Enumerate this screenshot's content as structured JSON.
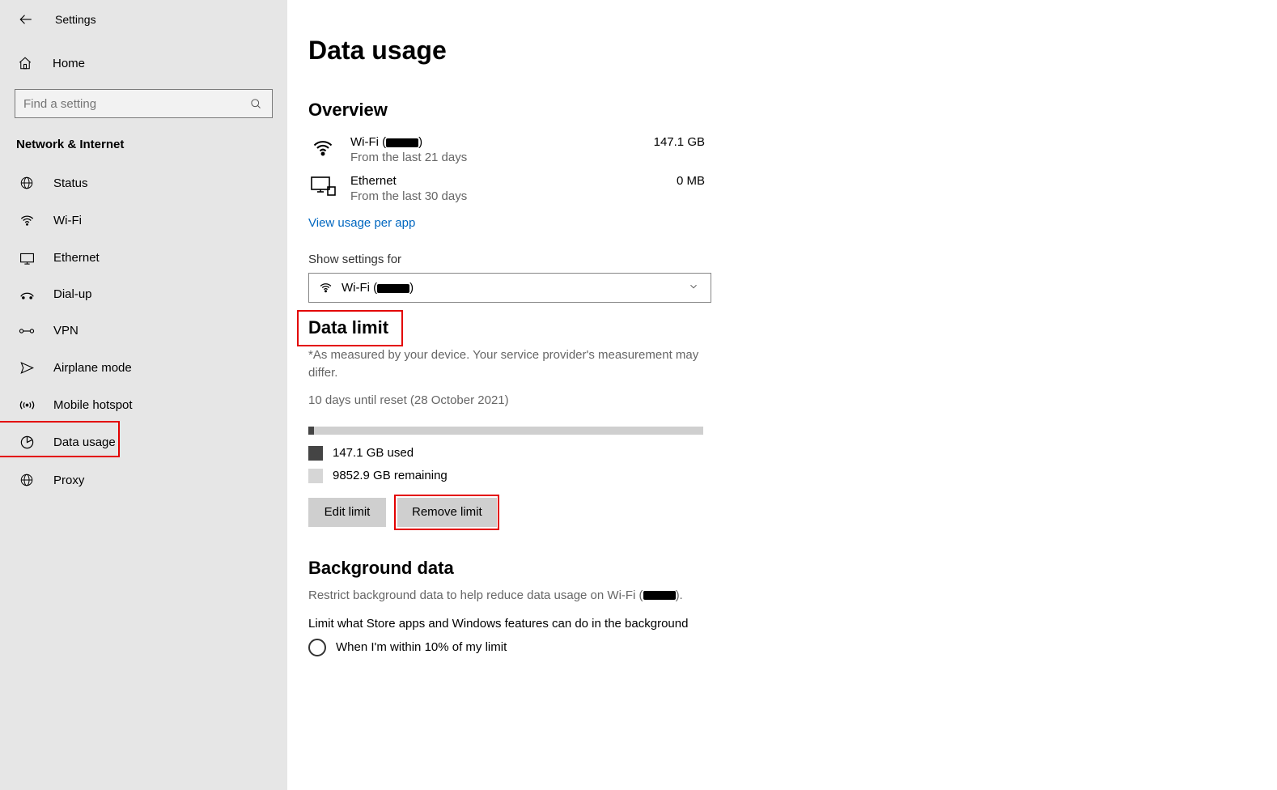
{
  "window": {
    "title": "Settings",
    "home_label": "Home",
    "search_placeholder": "Find a setting",
    "section_label": "Network & Internet"
  },
  "nav": {
    "status": "Status",
    "wifi": "Wi-Fi",
    "ethernet": "Ethernet",
    "dialup": "Dial-up",
    "vpn": "VPN",
    "airplane": "Airplane mode",
    "hotspot": "Mobile hotspot",
    "data_usage": "Data usage",
    "proxy": "Proxy"
  },
  "page": {
    "title": "Data usage",
    "overview_heading": "Overview",
    "wifi_name_prefix": "Wi-Fi (",
    "wifi_name_suffix": ")",
    "wifi_sub": "From the last 21 days",
    "wifi_value": "147.1 GB",
    "eth_name": "Ethernet",
    "eth_sub": "From the last 30 days",
    "eth_value": "0 MB",
    "view_per_app": "View usage per app",
    "show_for_label": "Show settings for",
    "dropdown_prefix": "Wi-Fi (",
    "dropdown_suffix": ")",
    "data_limit_heading": "Data limit",
    "data_limit_note": "*As measured by your device. Your service provider's measurement may differ.",
    "reset_note": "10 days until reset (28 October 2021)",
    "used_label": "147.1 GB used",
    "remaining_label": "9852.9 GB remaining",
    "edit_limit_btn": "Edit limit",
    "remove_limit_btn": "Remove limit",
    "bg_heading": "Background data",
    "bg_desc_prefix": "Restrict background data to help reduce data usage on Wi-Fi (",
    "bg_desc_suffix": ").",
    "bg_limit_label": "Limit what Store apps and Windows features can do in the background",
    "radio_option": "When I'm within 10% of my limit"
  }
}
